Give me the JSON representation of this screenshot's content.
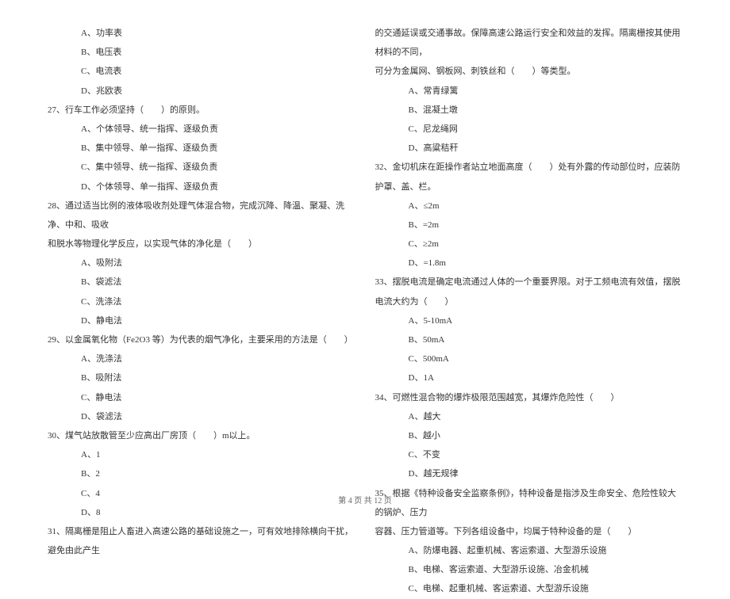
{
  "left_column": {
    "q26_options": [
      "A、功率表",
      "B、电压表",
      "C、电流表",
      "D、兆欧表"
    ],
    "q27": "27、行车工作必须坚持（　　）的原则。",
    "q27_options": [
      "A、个体领导、统一指挥、逐级负责",
      "B、集中领导、单一指挥、逐级负责",
      "C、集中领导、统一指挥、逐级负责",
      "D、个体领导、单一指挥、逐级负责"
    ],
    "q28_line1": "28、通过适当比例的液体吸收剂处理气体混合物，完成沉降、降温、聚凝、洗净、中和、吸收",
    "q28_line2": "和脱水等物理化学反应，以实现气体的净化是（　　）",
    "q28_options": [
      "A、吸附法",
      "B、袋滤法",
      "C、洗涤法",
      "D、静电法"
    ],
    "q29": "29、以金属氧化物（Fe2O3 等）为代表的烟气净化，主要采用的方法是（　　）",
    "q29_options": [
      "A、洗涤法",
      "B、吸附法",
      "C、静电法",
      "D、袋滤法"
    ],
    "q30": "30、煤气站放散管至少应高出厂房顶（　　）m以上。",
    "q30_options": [
      "A、1",
      "B、2",
      "C、4",
      "D、8"
    ],
    "q31": "31、隔离栅是阻止人畜进入高速公路的基础设施之一，可有效地排除横向干扰，避免由此产生"
  },
  "right_column": {
    "q31_cont1": "的交通延误或交通事故。保障高速公路运行安全和效益的发挥。隔离栅按其使用材料的不同，",
    "q31_cont2": "可分为金属网、钢板网、刺铁丝和（　　）等类型。",
    "q31_options": [
      "A、常青绿篱",
      "B、混凝土墩",
      "C、尼龙绳网",
      "D、高粱秸秆"
    ],
    "q32": "32、金切机床在距操作者站立地面高度（　　）处有外露的传动部位时，应装防护罩、盖、栏。",
    "q32_options": [
      "A、≤2m",
      "B、=2m",
      "C、≥2m",
      "D、=1.8m"
    ],
    "q33": "33、摆脱电流是确定电流通过人体的一个重要界限。对于工频电流有效值，摆脱电流大约为（　　）",
    "q33_options": [
      "A、5-10mA",
      "B、50mA",
      "C、500mA",
      "D、1A"
    ],
    "q34": "34、可燃性混合物的爆炸极限范围越宽，其爆炸危险性（　　）",
    "q34_options": [
      "A、越大",
      "B、越小",
      "C、不变",
      "D、越无规律"
    ],
    "q35_line1": "35、根据《特种设备安全监察条例》，特种设备是指涉及生命安全、危险性较大的锅炉、压力",
    "q35_line2": "容器、压力管道等。下列各组设备中，均属于特种设备的是（　　）",
    "q35_options": [
      "A、防爆电器、起重机械、客运索道、大型游乐设施",
      "B、电梯、客运索道、大型游乐设施、冶金机械",
      "C、电梯、起重机械、客运索道、大型游乐设施"
    ]
  },
  "footer": "第 4 页 共 12 页"
}
